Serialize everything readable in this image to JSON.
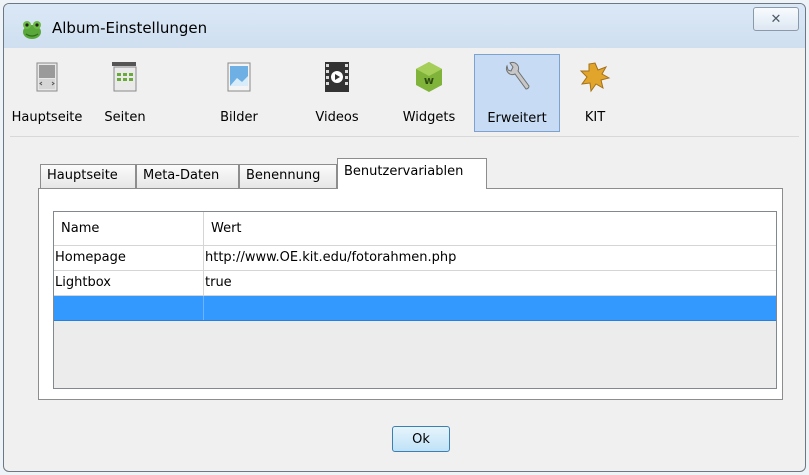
{
  "window": {
    "title": "Album-Einstellungen",
    "close_glyph": "✕"
  },
  "toolbar": {
    "items": [
      {
        "label": "Hauptseite",
        "icon": "mainpage-icon"
      },
      {
        "label": "Seiten",
        "icon": "pages-icon"
      },
      {
        "label": "Bilder",
        "icon": "images-icon"
      },
      {
        "label": "Videos",
        "icon": "video-icon"
      },
      {
        "label": "Widgets",
        "icon": "widget-icon"
      },
      {
        "label": "Erweitert",
        "icon": "wrench-icon",
        "active": true
      },
      {
        "label": "KIT",
        "icon": "kit-icon"
      }
    ]
  },
  "tabs": [
    {
      "label": "Hauptseite"
    },
    {
      "label": "Meta-Daten"
    },
    {
      "label": "Benennung"
    },
    {
      "label": "Benutzervariablen",
      "active": true
    }
  ],
  "grid": {
    "columns": [
      "Name",
      "Wert"
    ],
    "rows": [
      {
        "name": "Homepage",
        "value": "http://www.OE.kit.edu/fotorahmen.php"
      },
      {
        "name": "Lightbox",
        "value": "true"
      },
      {
        "name": "",
        "value": "",
        "selected": true
      }
    ]
  },
  "buttons": {
    "ok": "Ok"
  },
  "colors": {
    "selection": "#3399ff",
    "active_toolbar": "#c7dcf4"
  }
}
